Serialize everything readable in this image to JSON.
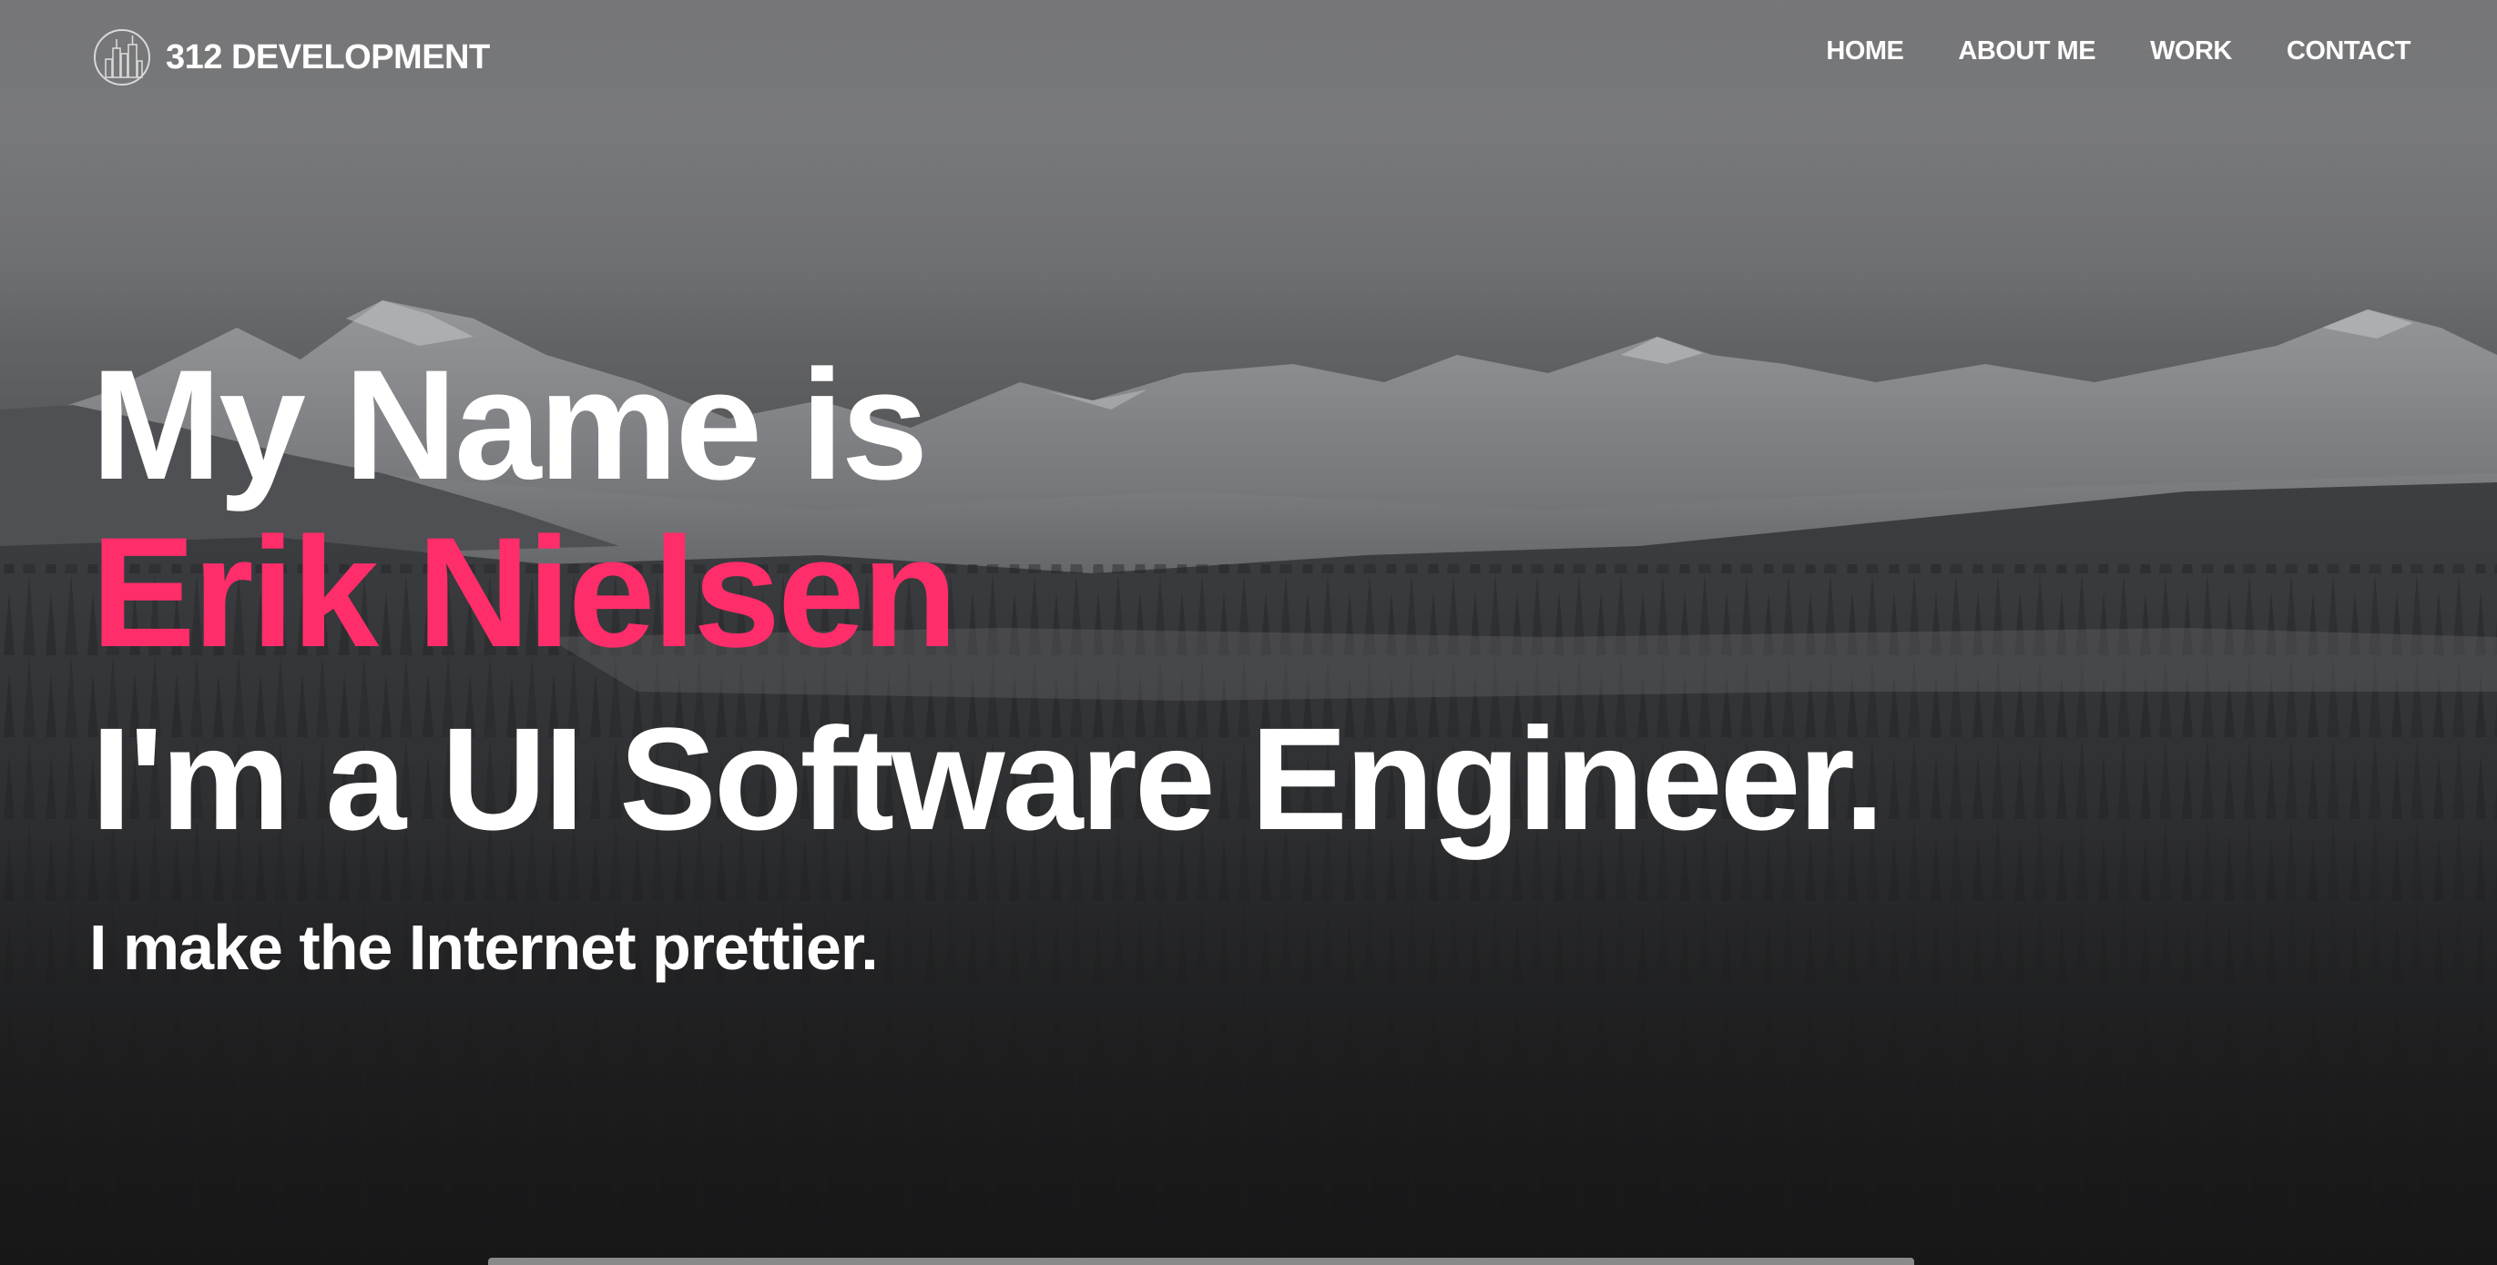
{
  "brand": {
    "name": "312 DEVELOPMENT",
    "logo_icon": "skyline-circle-icon"
  },
  "nav": {
    "items": [
      {
        "label": "HOME"
      },
      {
        "label": "ABOUT ME"
      },
      {
        "label": "WORK"
      },
      {
        "label": "CONTACT"
      }
    ]
  },
  "hero": {
    "intro": "My Name is",
    "name": "Erik Nielsen",
    "role": "I'm a UI Software Engineer.",
    "tagline": "I make the Internet prettier.",
    "background": "snowy mountains and forest"
  },
  "colors": {
    "accent": "#ff2d6a",
    "text": "#ffffff"
  }
}
